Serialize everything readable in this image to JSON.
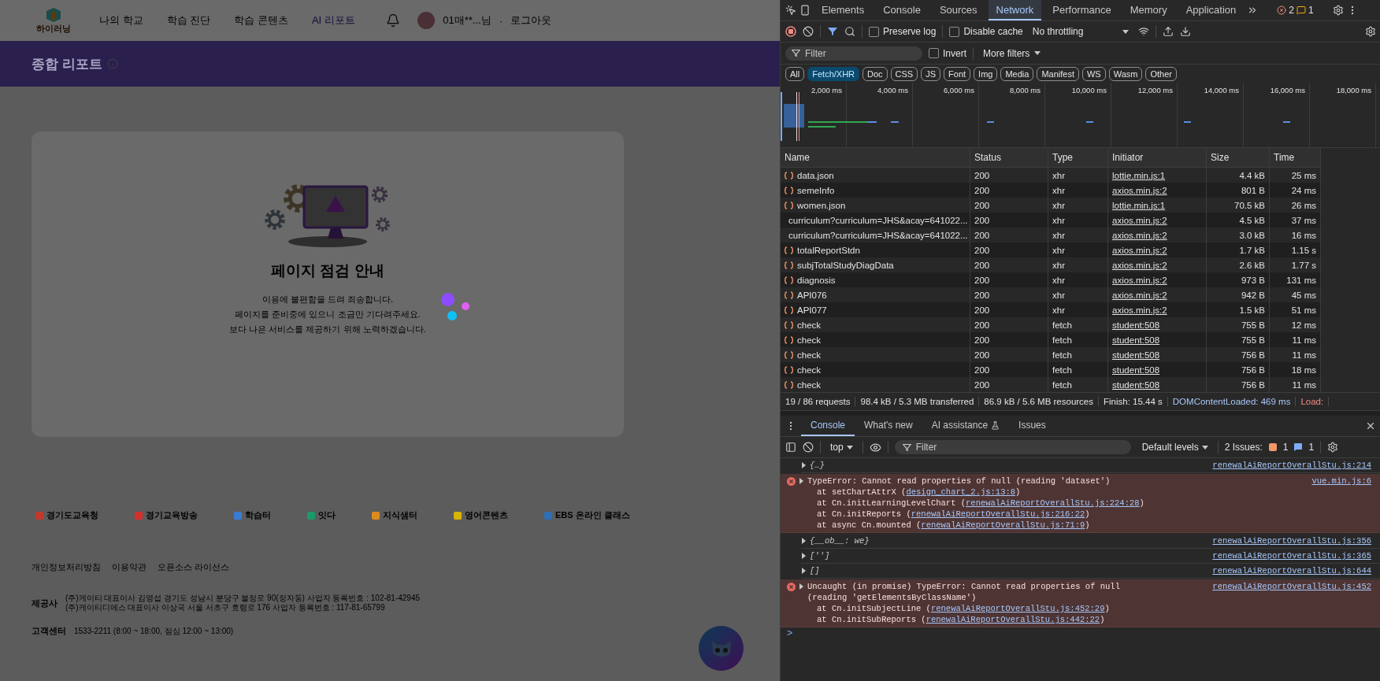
{
  "page": {
    "header": {
      "logo": "하이러닝",
      "nav": [
        {
          "label": "나의 학교",
          "selected": false
        },
        {
          "label": "학습 진단",
          "selected": false
        },
        {
          "label": "학습 콘텐츠",
          "selected": false
        },
        {
          "label": "AI 리포트",
          "selected": true
        }
      ],
      "user": "01매**...님",
      "separator": "·",
      "logout": "로그아웃"
    },
    "banner": {
      "title": "종합 리포트"
    },
    "notice": {
      "title": "페이지 점검 안내",
      "lines": [
        "이용에 불편함을 드려 죄송합니다.",
        "페이지를 준비중에 있으니 조금만 기다려주세요.",
        "보다 나은 서비스를 제공하기 위해 노력하겠습니다."
      ]
    },
    "partners": [
      {
        "label": "경기도교육청",
        "color": "#c0392b"
      },
      {
        "label": "경기교육방송",
        "color": "#d4302a"
      },
      {
        "label": "학습터",
        "color": "#3a7bd5"
      },
      {
        "label": "잇다",
        "color": "#1a9a6a"
      },
      {
        "label": "지식샘터",
        "color": "#e08a1e"
      },
      {
        "label": "영어콘텐츠",
        "color": "#d8b400"
      },
      {
        "label": "EBS 온라인 클래스",
        "color": "#2c6fb7"
      }
    ],
    "footer": {
      "links": [
        "개인정보처리방침",
        "이용약관",
        "오픈소스 라이선스"
      ],
      "provider_label": "제공사",
      "provider_lines": [
        "(주)케이티 대표이사 김영섭 경기도 성남시 분당구 불정로 90(정자동) 사업자 등록번호 : 102-81-42945",
        "(주)케이티디에스 대표이사 이상국 서울 서초구 효령로 176 사업자 등록번호 : 117-81-65799"
      ],
      "support_label": "고객센터",
      "support_text": "1533-2211 (8:00 ~ 18:00, 점심 12:00 ~ 13:00)"
    }
  },
  "devtools": {
    "panel_tabs": [
      {
        "label": "Elements",
        "selected": false
      },
      {
        "label": "Console",
        "selected": false
      },
      {
        "label": "Sources",
        "selected": false
      },
      {
        "label": "Network",
        "selected": true
      },
      {
        "label": "Performance",
        "selected": false
      },
      {
        "label": "Memory",
        "selected": false
      },
      {
        "label": "Application",
        "selected": false
      }
    ],
    "error_count": "2",
    "warning_count": "1",
    "toolbar": {
      "preserve_log": {
        "label": "Preserve log",
        "checked": false
      },
      "disable_cache": {
        "label": "Disable cache",
        "checked": false
      },
      "throttling": "No throttling"
    },
    "filter": {
      "placeholder": "Filter",
      "invert": {
        "label": "Invert",
        "checked": false
      },
      "more_filters": "More filters"
    },
    "type_filters": [
      {
        "label": "All",
        "selected": false
      },
      {
        "label": "Fetch/XHR",
        "selected": true
      },
      {
        "label": "Doc",
        "selected": false
      },
      {
        "label": "CSS",
        "selected": false
      },
      {
        "label": "JS",
        "selected": false
      },
      {
        "label": "Font",
        "selected": false
      },
      {
        "label": "Img",
        "selected": false
      },
      {
        "label": "Media",
        "selected": false
      },
      {
        "label": "Manifest",
        "selected": false
      },
      {
        "label": "WS",
        "selected": false
      },
      {
        "label": "Wasm",
        "selected": false
      },
      {
        "label": "Other",
        "selected": false
      }
    ],
    "overview_ticks": [
      "2,000 ms",
      "4,000 ms",
      "6,000 ms",
      "8,000 ms",
      "10,000 ms",
      "12,000 ms",
      "14,000 ms",
      "16,000 ms",
      "18,000 ms"
    ],
    "table": {
      "columns": [
        "Name",
        "Status",
        "Type",
        "Initiator",
        "Size",
        "Time"
      ],
      "rows": [
        {
          "name": "data.json",
          "status": "200",
          "type": "xhr",
          "initiator": "lottie.min.js:1",
          "size": "4.4 kB",
          "time": "25 ms"
        },
        {
          "name": "semeInfo",
          "status": "200",
          "type": "xhr",
          "initiator": "axios.min.js:2",
          "size": "801 B",
          "time": "24 ms"
        },
        {
          "name": "women.json",
          "status": "200",
          "type": "xhr",
          "initiator": "lottie.min.js:1",
          "size": "70.5 kB",
          "time": "26 ms"
        },
        {
          "name": "curriculum?curriculum=JHS&acay=641022...",
          "status": "200",
          "type": "xhr",
          "initiator": "axios.min.js:2",
          "size": "4.5 kB",
          "time": "37 ms"
        },
        {
          "name": "curriculum?curriculum=JHS&acay=641022...",
          "status": "200",
          "type": "xhr",
          "initiator": "axios.min.js:2",
          "size": "3.0 kB",
          "time": "16 ms"
        },
        {
          "name": "totalReportStdn",
          "status": "200",
          "type": "xhr",
          "initiator": "axios.min.js:2",
          "size": "1.7 kB",
          "time": "1.15 s"
        },
        {
          "name": "subjTotalStudyDiagData",
          "status": "200",
          "type": "xhr",
          "initiator": "axios.min.js:2",
          "size": "2.6 kB",
          "time": "1.77 s"
        },
        {
          "name": "diagnosis",
          "status": "200",
          "type": "xhr",
          "initiator": "axios.min.js:2",
          "size": "973 B",
          "time": "131 ms"
        },
        {
          "name": "API076",
          "status": "200",
          "type": "xhr",
          "initiator": "axios.min.js:2",
          "size": "942 B",
          "time": "45 ms"
        },
        {
          "name": "API077",
          "status": "200",
          "type": "xhr",
          "initiator": "axios.min.js:2",
          "size": "1.5 kB",
          "time": "51 ms"
        },
        {
          "name": "check",
          "status": "200",
          "type": "fetch",
          "initiator": "student:508",
          "size": "755 B",
          "time": "12 ms"
        },
        {
          "name": "check",
          "status": "200",
          "type": "fetch",
          "initiator": "student:508",
          "size": "755 B",
          "time": "11 ms"
        },
        {
          "name": "check",
          "status": "200",
          "type": "fetch",
          "initiator": "student:508",
          "size": "756 B",
          "time": "11 ms"
        },
        {
          "name": "check",
          "status": "200",
          "type": "fetch",
          "initiator": "student:508",
          "size": "756 B",
          "time": "18 ms"
        },
        {
          "name": "check",
          "status": "200",
          "type": "fetch",
          "initiator": "student:508",
          "size": "756 B",
          "time": "11 ms"
        }
      ]
    },
    "summary": [
      {
        "kind": "plain",
        "text": "19 / 86 requests"
      },
      {
        "kind": "plain",
        "text": "98.4 kB / 5.3 MB transferred"
      },
      {
        "kind": "plain",
        "text": "86.9 kB / 5.6 MB resources"
      },
      {
        "kind": "plain",
        "text": "Finish: 15.44 s"
      },
      {
        "kind": "blue",
        "text": "DOMContentLoaded: 469 ms"
      },
      {
        "kind": "red",
        "text": "Load:"
      }
    ],
    "drawer_tabs": [
      {
        "label": "Console",
        "selected": true
      },
      {
        "label": "What's new",
        "selected": false
      },
      {
        "label": "AI assistance",
        "selected": false
      },
      {
        "label": "Issues",
        "selected": false
      }
    ],
    "console_toolbar": {
      "context": "top",
      "filter_placeholder": "Filter",
      "levels": "Default levels",
      "issues_label": "2 Issues:",
      "issue_warnings": "1",
      "issue_infos": "1"
    },
    "messages": [
      {
        "kind": "log",
        "text": "{…}",
        "source": "renewalAiReportOverallStu.js:214"
      },
      {
        "kind": "error",
        "text": "TypeError: Cannot read properties of null (reading 'dataset')",
        "source": "vue.min.js:6",
        "stack": [
          {
            "pre": "at setChartAttrX (",
            "link": "design_chart_2.js:13:8",
            "post": ")"
          },
          {
            "pre": "at Cn.initLearningLevelChart (",
            "link": "renewalAiReportOverallStu.js:224:28",
            "post": ")"
          },
          {
            "pre": "at Cn.initReports (",
            "link": "renewalAiReportOverallStu.js:216:22",
            "post": ")"
          },
          {
            "pre": "at async Cn.mounted (",
            "link": "renewalAiReportOverallStu.js:71:9",
            "post": ")"
          }
        ]
      },
      {
        "kind": "log",
        "text": "{__ob__: we}",
        "source": "renewalAiReportOverallStu.js:356"
      },
      {
        "kind": "log",
        "text": "['']",
        "source": "renewalAiReportOverallStu.js:365"
      },
      {
        "kind": "log",
        "text": "[]",
        "source": "renewalAiReportOverallStu.js:644"
      },
      {
        "kind": "error",
        "text": "Uncaught (in promise) TypeError: Cannot read properties of null (reading 'getElementsByClassName')",
        "source": "renewalAiReportOverallStu.js:452",
        "stack": [
          {
            "pre": "at Cn.initSubjectLine (",
            "link": "renewalAiReportOverallStu.js:452:29",
            "post": ")"
          },
          {
            "pre": "at Cn.initSubReports (",
            "link": "renewalAiReportOverallStu.js:442:22",
            "post": ")"
          }
        ]
      }
    ],
    "prompt": ">"
  }
}
